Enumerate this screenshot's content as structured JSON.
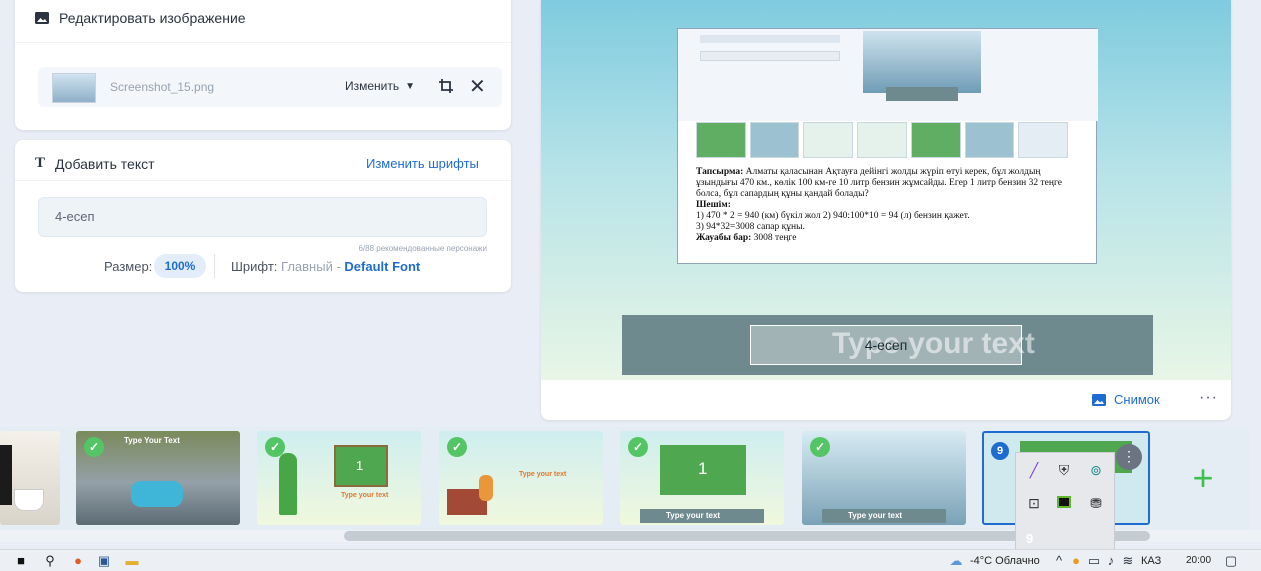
{
  "edit_panel": {
    "title": "Редактировать изображение",
    "file_name": "Screenshot_15.png",
    "change_label": "Изменить"
  },
  "text_panel": {
    "title": "Добавить текст",
    "change_fonts": "Изменить шрифты",
    "input_value": "4-есеп",
    "char_count": "6/88 рекомендованные персонажи",
    "size_label": "Размер:",
    "size_value": "100%",
    "font_label": "Шрифт:",
    "font_main": "Главный -",
    "font_default": "Default Font"
  },
  "preview": {
    "doc": {
      "task_label": "Тапсырма:",
      "task_text": "Алматы қаласынан Ақтауға дейінгі жолды жүріп өтуі керек, бұл жолдың ұзындығы 470 км., көлік 100 км-ге 10 литр бензин жұмсайды. Егер 1 литр бензин 32 теңге болса, бұл сапардың құны қандай болады?",
      "solution_label": "Шешім:",
      "line1": "1) 470 * 2 = 940 (км) бүкіл жол 2) 940:100*10 = 94 (л) бензин қажет.",
      "line2": "3) 94*32=3008 сапар құны.",
      "answer_label": "Жауабы бар:",
      "answer_text": "3008 теңге"
    },
    "band_placeholder": "Type your text",
    "band_text": "4-есеп",
    "snapshot_label": "Снимок",
    "more": "···"
  },
  "filmstrip": {
    "thumbs": [
      {
        "label": "Type Your Text"
      },
      {
        "label": "1",
        "sub": "Type your text"
      },
      {
        "label": "Type your text"
      },
      {
        "label": "1",
        "sub": "Type your text"
      },
      {
        "label": "Type your text"
      },
      {
        "badge": "9"
      }
    ],
    "add": "+"
  },
  "tray": {
    "ghost": "9"
  },
  "taskbar": {
    "weather": "-4°C Облачно",
    "lang": "КАЗ",
    "time": "20:00"
  },
  "colors": {
    "accent": "#1f6cd1",
    "green": "#54c565"
  }
}
